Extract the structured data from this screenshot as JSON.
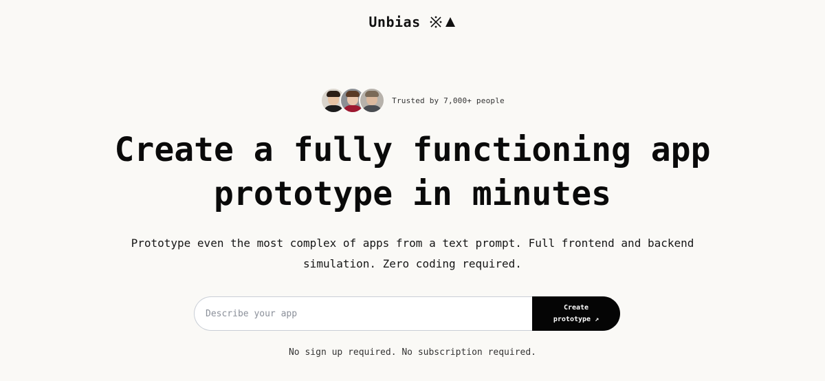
{
  "header": {
    "brand_name": "Unbias",
    "logo_icons": [
      "asterisk-x-icon",
      "triangle-icon"
    ]
  },
  "trust": {
    "text": "Trusted by 7,000+ people",
    "avatars": [
      "avatar-man-dark-hair",
      "avatar-woman-red-top",
      "avatar-man-light-hair"
    ]
  },
  "hero": {
    "headline_line1": "Create a fully functioning app",
    "headline_line2": "prototype in minutes",
    "subtitle": "Prototype even the most complex of apps from a text prompt. Full frontend and backend simulation. Zero coding required."
  },
  "prompt": {
    "placeholder": "Describe your app",
    "value": "",
    "button_label": "Create prototype ↗"
  },
  "note": "No sign up required. No subscription required.",
  "colors": {
    "background": "#faf9f6",
    "button": "#050505",
    "text": "#111111"
  }
}
